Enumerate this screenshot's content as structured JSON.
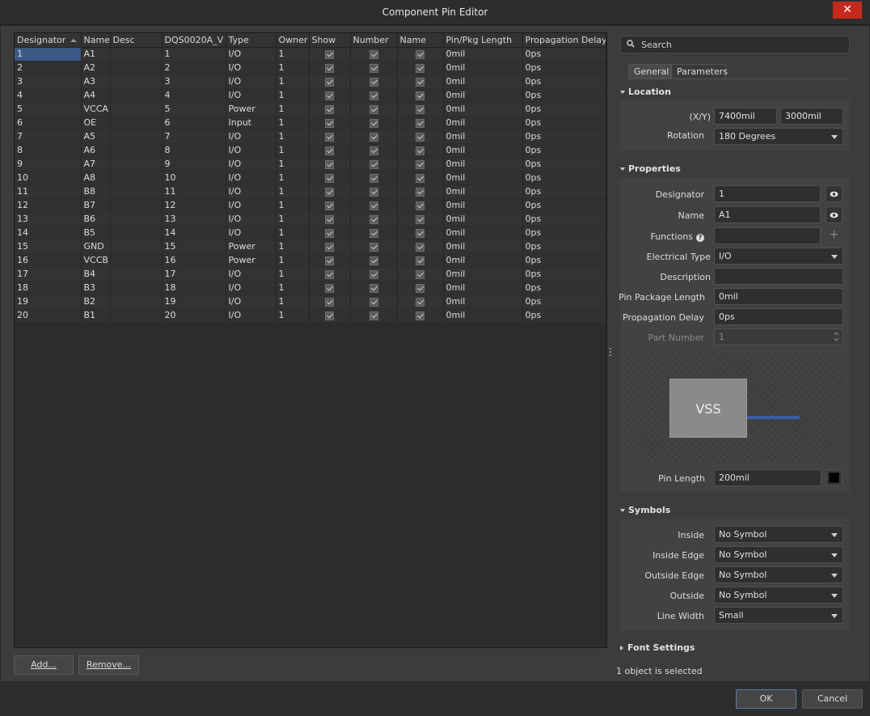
{
  "window": {
    "title": "Component Pin Editor",
    "close_glyph": "✕"
  },
  "table": {
    "columns": [
      "Designator",
      "Name",
      "Desc",
      "DQS0020A_V",
      "Type",
      "Owner",
      "Show",
      "Number",
      "Name",
      "Pin/Pkg Length",
      "Propagation Delay"
    ],
    "rows": [
      {
        "designator": "1",
        "name": "A1",
        "desc": "",
        "pkg": "1",
        "type": "I/O",
        "owner": "1",
        "length": "0mil",
        "delay": "0ps"
      },
      {
        "designator": "2",
        "name": "A2",
        "desc": "",
        "pkg": "2",
        "type": "I/O",
        "owner": "1",
        "length": "0mil",
        "delay": "0ps"
      },
      {
        "designator": "3",
        "name": "A3",
        "desc": "",
        "pkg": "3",
        "type": "I/O",
        "owner": "1",
        "length": "0mil",
        "delay": "0ps"
      },
      {
        "designator": "4",
        "name": "A4",
        "desc": "",
        "pkg": "4",
        "type": "I/O",
        "owner": "1",
        "length": "0mil",
        "delay": "0ps"
      },
      {
        "designator": "5",
        "name": "VCCA",
        "desc": "",
        "pkg": "5",
        "type": "Power",
        "owner": "1",
        "length": "0mil",
        "delay": "0ps"
      },
      {
        "designator": "6",
        "name": "OE",
        "desc": "",
        "pkg": "6",
        "type": "Input",
        "owner": "1",
        "length": "0mil",
        "delay": "0ps"
      },
      {
        "designator": "7",
        "name": "A5",
        "desc": "",
        "pkg": "7",
        "type": "I/O",
        "owner": "1",
        "length": "0mil",
        "delay": "0ps"
      },
      {
        "designator": "8",
        "name": "A6",
        "desc": "",
        "pkg": "8",
        "type": "I/O",
        "owner": "1",
        "length": "0mil",
        "delay": "0ps"
      },
      {
        "designator": "9",
        "name": "A7",
        "desc": "",
        "pkg": "9",
        "type": "I/O",
        "owner": "1",
        "length": "0mil",
        "delay": "0ps"
      },
      {
        "designator": "10",
        "name": "A8",
        "desc": "",
        "pkg": "10",
        "type": "I/O",
        "owner": "1",
        "length": "0mil",
        "delay": "0ps"
      },
      {
        "designator": "11",
        "name": "B8",
        "desc": "",
        "pkg": "11",
        "type": "I/O",
        "owner": "1",
        "length": "0mil",
        "delay": "0ps"
      },
      {
        "designator": "12",
        "name": "B7",
        "desc": "",
        "pkg": "12",
        "type": "I/O",
        "owner": "1",
        "length": "0mil",
        "delay": "0ps"
      },
      {
        "designator": "13",
        "name": "B6",
        "desc": "",
        "pkg": "13",
        "type": "I/O",
        "owner": "1",
        "length": "0mil",
        "delay": "0ps"
      },
      {
        "designator": "14",
        "name": "B5",
        "desc": "",
        "pkg": "14",
        "type": "I/O",
        "owner": "1",
        "length": "0mil",
        "delay": "0ps"
      },
      {
        "designator": "15",
        "name": "GND",
        "desc": "",
        "pkg": "15",
        "type": "Power",
        "owner": "1",
        "length": "0mil",
        "delay": "0ps"
      },
      {
        "designator": "16",
        "name": "VCCB",
        "desc": "",
        "pkg": "16",
        "type": "Power",
        "owner": "1",
        "length": "0mil",
        "delay": "0ps"
      },
      {
        "designator": "17",
        "name": "B4",
        "desc": "",
        "pkg": "17",
        "type": "I/O",
        "owner": "1",
        "length": "0mil",
        "delay": "0ps"
      },
      {
        "designator": "18",
        "name": "B3",
        "desc": "",
        "pkg": "18",
        "type": "I/O",
        "owner": "1",
        "length": "0mil",
        "delay": "0ps"
      },
      {
        "designator": "19",
        "name": "B2",
        "desc": "",
        "pkg": "19",
        "type": "I/O",
        "owner": "1",
        "length": "0mil",
        "delay": "0ps"
      },
      {
        "designator": "20",
        "name": "B1",
        "desc": "",
        "pkg": "20",
        "type": "I/O",
        "owner": "1",
        "length": "0mil",
        "delay": "0ps"
      }
    ]
  },
  "buttons": {
    "add": "Add...",
    "remove": "Remove...",
    "ok": "OK",
    "cancel": "Cancel"
  },
  "search": {
    "placeholder": "Search"
  },
  "tabs": [
    "General",
    "Parameters"
  ],
  "location": {
    "title": "Location",
    "xy_label": "(X/Y)",
    "x": "7400mil",
    "y": "3000mil",
    "rotation_label": "Rotation",
    "rotation": "180 Degrees"
  },
  "properties": {
    "title": "Properties",
    "designator_label": "Designator",
    "designator": "1",
    "name_label": "Name",
    "name": "A1",
    "functions_label": "Functions",
    "functions": "",
    "electrical_type_label": "Electrical Type",
    "electrical_type": "I/O",
    "description_label": "Description",
    "description": "",
    "pin_package_length_label": "Pin Package Length",
    "pin_package_length": "0mil",
    "propagation_delay_label": "Propagation Delay",
    "propagation_delay": "0ps",
    "part_number_label": "Part Number",
    "part_number": "1",
    "preview_text": "VSS",
    "pin_length_label": "Pin Length",
    "pin_length": "200mil",
    "pin_color": "#000000"
  },
  "symbols": {
    "title": "Symbols",
    "inside_label": "Inside",
    "inside": "No Symbol",
    "inside_edge_label": "Inside Edge",
    "inside_edge": "No Symbol",
    "outside_edge_label": "Outside Edge",
    "outside_edge": "No Symbol",
    "outside_label": "Outside",
    "outside": "No Symbol",
    "line_width_label": "Line Width",
    "line_width": "Small"
  },
  "font_settings": {
    "title": "Font Settings"
  },
  "status": "1 object is selected",
  "colors": {
    "selection": "#3a5a85",
    "pin": "#3c5ca8",
    "close": "#c42b1c"
  }
}
